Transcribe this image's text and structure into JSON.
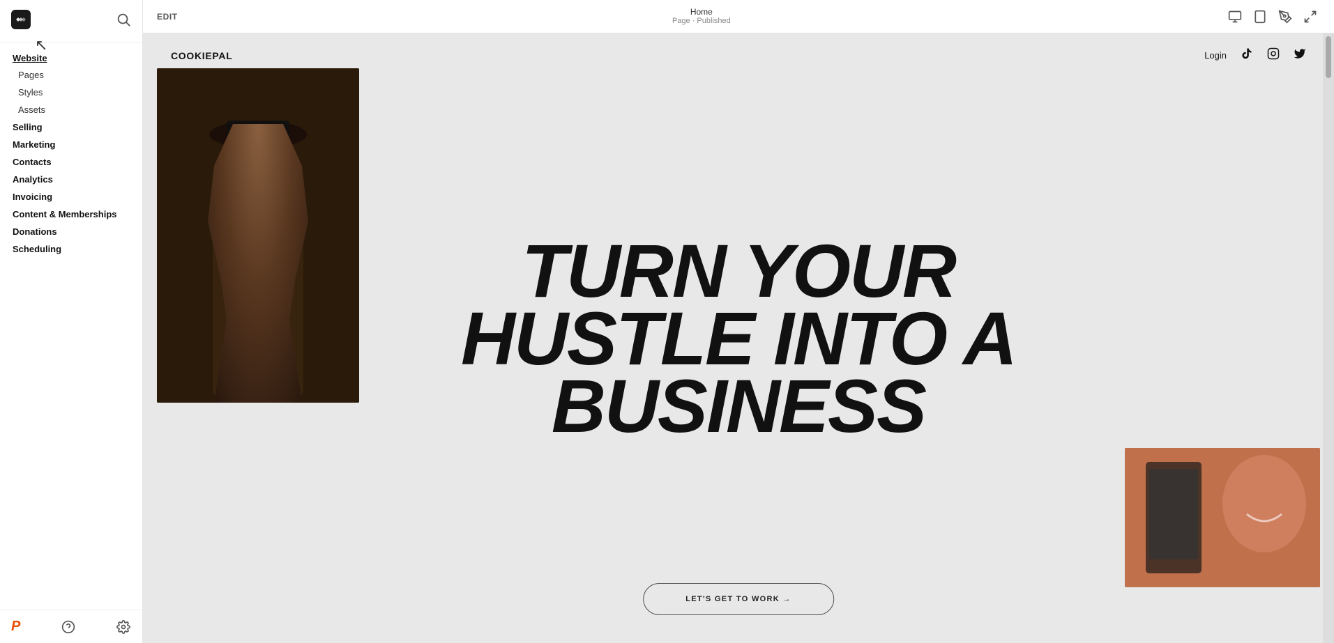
{
  "sidebar": {
    "logo_alt": "Squarespace logo",
    "nav": {
      "website_label": "Website",
      "items": [
        {
          "id": "pages",
          "label": "Pages",
          "indent": true
        },
        {
          "id": "styles",
          "label": "Styles",
          "indent": true
        },
        {
          "id": "assets",
          "label": "Assets",
          "indent": true
        },
        {
          "id": "selling",
          "label": "Selling",
          "indent": false
        },
        {
          "id": "marketing",
          "label": "Marketing",
          "indent": false
        },
        {
          "id": "contacts",
          "label": "Contacts",
          "indent": false
        },
        {
          "id": "analytics",
          "label": "Analytics",
          "indent": false
        },
        {
          "id": "invoicing",
          "label": "Invoicing",
          "indent": false
        },
        {
          "id": "content-memberships",
          "label": "Content & Memberships",
          "indent": false
        },
        {
          "id": "donations",
          "label": "Donations",
          "indent": false
        },
        {
          "id": "scheduling",
          "label": "Scheduling",
          "indent": false
        }
      ]
    },
    "bottom": {
      "p_icon": "P",
      "help_icon": "help-circle-icon",
      "settings_icon": "settings-icon"
    }
  },
  "topbar": {
    "edit_label": "EDIT",
    "page_name": "Home",
    "page_status": "Page · Published",
    "icons": {
      "desktop": "desktop-icon",
      "tablet": "tablet-icon",
      "pen": "pen-icon",
      "expand": "expand-icon"
    }
  },
  "preview": {
    "website_logo": "COOKIEPAL",
    "login_label": "Login",
    "social_icons": [
      "tiktok-icon",
      "instagram-icon",
      "twitter-icon"
    ],
    "hero_line1": "TURN YOUR",
    "hero_line2": "HUSTLE INTO A",
    "hero_line3": "BUSINESS",
    "cta_button": "LET'S GET TO WORK →"
  }
}
